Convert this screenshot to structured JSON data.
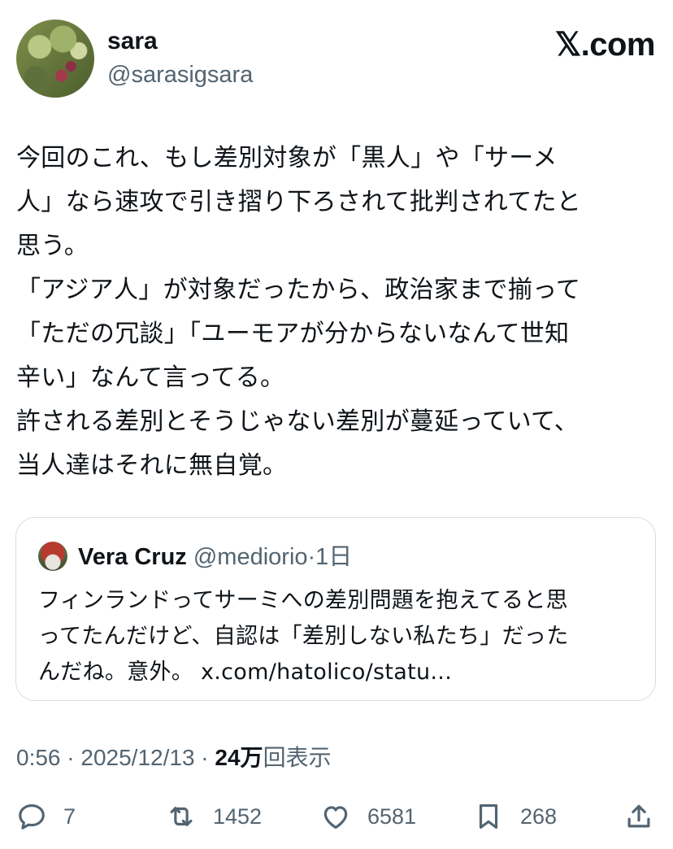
{
  "author": {
    "display_name": "sara",
    "handle": "@sarasigsara"
  },
  "brand": "𝕏.com",
  "tweet": {
    "text": "今回のこれ、もし差別対象が「黒人」や「サーメ\n人」なら速攻で引き摺り下ろされて批判されてたと\n思う。\n「アジア人」が対象だったから、政治家まで揃って\n「ただの冗談」「ユーモアが分からないなんて世知\n辛い」なんて言ってる。\n許される差別とそうじゃない差別が蔓延っていて、\n当人達はそれに無自覚。"
  },
  "quote": {
    "display_name": "Vera Cruz",
    "handle": "@mediorio",
    "age": "·1日",
    "text": "フィンランドってサーミへの差別問題を抱えてると思\nってたんだけど、自認は「差別しない私たち」だった\nんだね。意外。 x.com/hatolico/statu..."
  },
  "meta": {
    "time": "0:56 · 2025/12/13 · ",
    "views_count": "24万",
    "views_label": "回表示"
  },
  "actions": {
    "replies": "7",
    "reposts": "1452",
    "likes": "6581",
    "bookmarks": "268"
  },
  "icons": [
    "reply-icon",
    "repost-icon",
    "like-icon",
    "bookmark-icon",
    "share-icon"
  ]
}
